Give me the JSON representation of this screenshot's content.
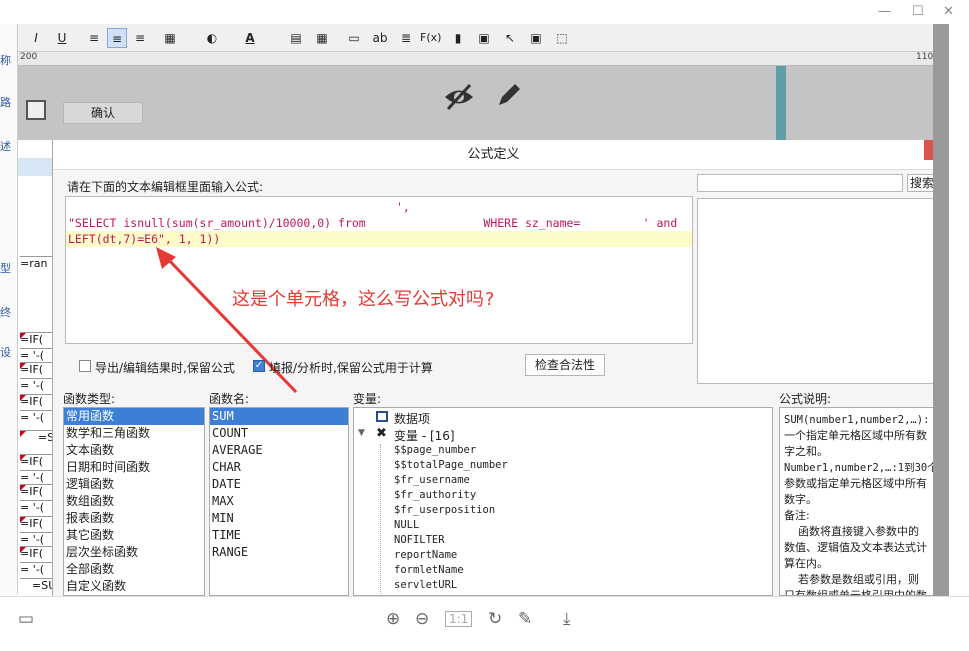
{
  "toolbar": {
    "items": [
      "I",
      "U",
      "≡",
      "≡",
      "≡",
      "▦",
      "◐",
      "A",
      "▤",
      "▦",
      "▭",
      "ab",
      "≣",
      "F(x)",
      "▮",
      "▣",
      "↖",
      "▣",
      "⬚"
    ]
  },
  "ruler": {
    "ticks": [
      "200",
      "110"
    ]
  },
  "gray_area": {
    "confirm_label": "确认"
  },
  "left_sidebar": {
    "labels": [
      "称",
      "路",
      "述",
      "型",
      "终",
      "设"
    ]
  },
  "sheet": {
    "header_label": "=ran",
    "cells": [
      "=IF(",
      "= '-(",
      "=IF(",
      "= '-(",
      "=IF(",
      "= '-(",
      "=S",
      "=IF(",
      "= '-(",
      "=IF(",
      "= '-(",
      "=IF(",
      "= '-(",
      "=IF(",
      "= '-(",
      "=SU"
    ]
  },
  "dialog": {
    "title": "公式定义",
    "prompt": "请在下面的文本编辑框里面输入公式:",
    "code_lines": [
      "',",
      "\"SELECT isnull(sum(sr_amount)/10000,0) from                 WHERE sz_name=         ' and",
      "LEFT(dt,7)=E6\", 1, 1))"
    ],
    "annotation": "这是个单元格，这么写公式对吗?",
    "search_button": "搜索",
    "export_checkbox": "导出/编辑结果时,保留公式",
    "fill_checkbox": "填报/分析时,保留公式用于计算",
    "check_button": "检查合法性",
    "func_type_label": "函数类型:",
    "func_types": [
      "常用函数",
      "数学和三角函数",
      "文本函数",
      "日期和时间函数",
      "逻辑函数",
      "数组函数",
      "报表函数",
      "其它函数",
      "层次坐标函数",
      "全部函数",
      "自定义函数"
    ],
    "func_name_label": "函数名:",
    "func_names": [
      "SUM",
      "COUNT",
      "AVERAGE",
      "CHAR",
      "DATE",
      "MAX",
      "MIN",
      "TIME",
      "RANGE"
    ],
    "variables_label": "变量:",
    "data_item": "数据项",
    "var_group": "变量 - [16]",
    "variables": [
      "$$page_number",
      "$$totalPage_number",
      "$fr_username",
      "$fr_authority",
      "$fr_userposition",
      "NULL",
      "NOFILTER",
      "reportName",
      "formletName",
      "servletURL"
    ],
    "desc_label": "公式说明:",
    "desc_lines": [
      "SUM(number1,number2,…):",
      "一个指定单元格区域中所有数",
      "字之和。",
      "Number1,number2,…:1到30个",
      "参数或指定单元格区域中所有",
      "数字。",
      "备注:",
      "    函数将直接键入参数中的",
      "数值、逻辑值及文本表达式计",
      "算在内。",
      "    若参数是数组或引用，则",
      "只有数组或单元格引用中的数"
    ]
  },
  "bottom_bar": {
    "icons": [
      "layout-icon",
      "zoom-in-icon",
      "zoom-out-icon",
      "fit-icon",
      "rotate-icon",
      "edit-icon",
      "download-icon"
    ]
  }
}
